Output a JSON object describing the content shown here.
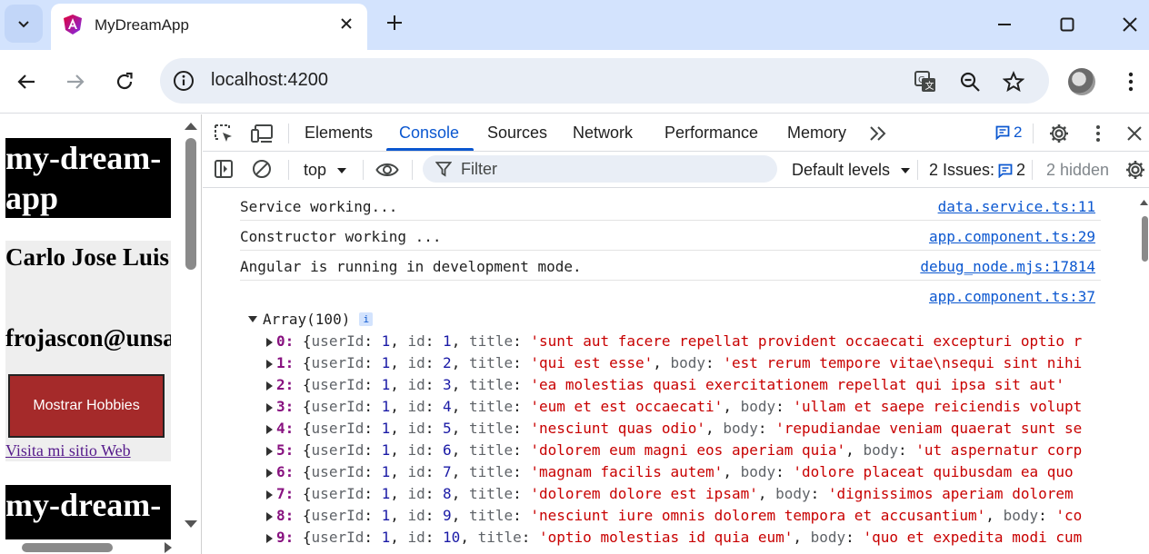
{
  "browser": {
    "tab_title": "MyDreamApp",
    "url": "localhost:4200"
  },
  "page": {
    "app_title": "my-dream-app",
    "name": "Carlo Jose Luis",
    "email": "frojascon@unsa",
    "hobbies_button": "Mostrar Hobbies",
    "site_link": "Visita mi sitio Web",
    "app_title_repeat": "my-dream-"
  },
  "devtools": {
    "tabs": [
      "Elements",
      "Console",
      "Sources",
      "Network",
      "Performance",
      "Memory"
    ],
    "active_tab": "Console",
    "issue_count": "2",
    "context": "top",
    "filter_placeholder": "Filter",
    "levels": "Default levels",
    "issues_label": "2 Issues:",
    "issues_badge": "2",
    "hidden_label": "2 hidden"
  },
  "console": {
    "logs": [
      {
        "text": "Service working...",
        "source": "data.service.ts:11"
      },
      {
        "text": "Constructor working ...",
        "source": "app.component.ts:29"
      },
      {
        "text": "Angular is running in development mode.",
        "source": "debug_node.mjs:17814"
      },
      {
        "text": "",
        "source": "app.component.ts:37"
      }
    ],
    "array_label": "Array(100)",
    "items": [
      {
        "idx": "0",
        "userId": "1",
        "id": "1",
        "title": "'sunt aut facere repellat provident occaecati excepturi optio r",
        "body": ""
      },
      {
        "idx": "1",
        "userId": "1",
        "id": "2",
        "title": "'qui est esse'",
        "body": "'est rerum tempore vitae\\nsequi sint nihi"
      },
      {
        "idx": "2",
        "userId": "1",
        "id": "3",
        "title": "'ea molestias quasi exercitationem repellat qui ipsa sit aut'",
        "body": ""
      },
      {
        "idx": "3",
        "userId": "1",
        "id": "4",
        "title": "'eum et est occaecati'",
        "body": "'ullam et saepe reiciendis volupt"
      },
      {
        "idx": "4",
        "userId": "1",
        "id": "5",
        "title": "'nesciunt quas odio'",
        "body": "'repudiandae veniam quaerat sunt se"
      },
      {
        "idx": "5",
        "userId": "1",
        "id": "6",
        "title": "'dolorem eum magni eos aperiam quia'",
        "body": "'ut aspernatur corp"
      },
      {
        "idx": "6",
        "userId": "1",
        "id": "7",
        "title": "'magnam facilis autem'",
        "body": "'dolore placeat quibusdam ea quo"
      },
      {
        "idx": "7",
        "userId": "1",
        "id": "8",
        "title": "'dolorem dolore est ipsam'",
        "body": "'dignissimos aperiam dolorem"
      },
      {
        "idx": "8",
        "userId": "1",
        "id": "9",
        "title": "'nesciunt iure omnis dolorem tempora et accusantium'",
        "body": "'co"
      },
      {
        "idx": "9",
        "userId": "1",
        "id": "10",
        "title": "'optio molestias id quia eum'",
        "body": "'quo et expedita modi cum"
      }
    ]
  },
  "colors": {
    "tabstrip": "#d3e3fd",
    "accent": "#0b57d0",
    "hobby_button": "#a52a2a"
  }
}
